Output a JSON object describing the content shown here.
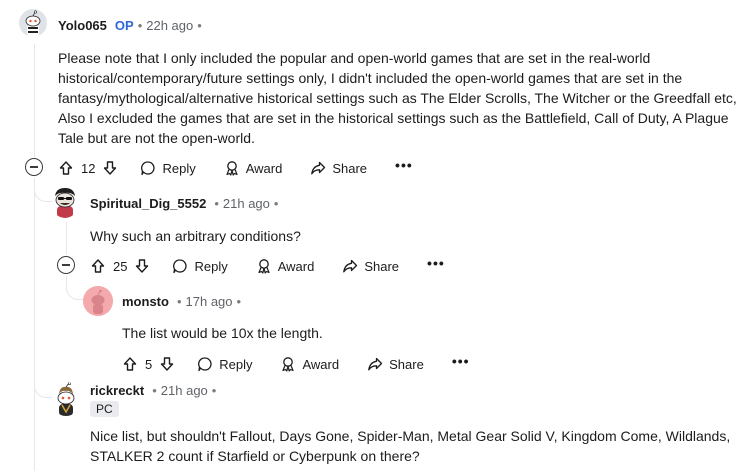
{
  "comments": [
    {
      "username": "Yolo065",
      "op_badge": "OP",
      "time": "22h ago",
      "text_lines": [
        "Please note that I only included the popular and open-world games that are set in the real-world",
        "historical/contemporary/future settings only, I didn't included the open-world games that are set in the",
        "fantasy/mythological/alternative historical settings such as The Elder Scrolls, The Witcher or the Greedfall etc,",
        "Also I excluded the games that are set in the historical settings such as the Battlefield, Call of Duty, A Plague",
        "Tale but are not the open-world."
      ],
      "votes": "12",
      "reply_label": "Reply",
      "award_label": "Award",
      "share_label": "Share",
      "more_label": "•••"
    },
    {
      "username": "Spiritual_Dig_5552",
      "time": "21h ago",
      "text": "Why such an arbitrary conditions?",
      "votes": "25",
      "reply_label": "Reply",
      "award_label": "Award",
      "share_label": "Share",
      "more_label": "•••"
    },
    {
      "username": "monsto",
      "time": "17h ago",
      "text": "The list would be 10x the length.",
      "votes": "5",
      "reply_label": "Reply",
      "award_label": "Award",
      "share_label": "Share",
      "more_label": "•••"
    },
    {
      "username": "rickreckt",
      "time": "21h ago",
      "flair": "PC",
      "text_lines": [
        "Nice list, but shouldn't Fallout, Days Gone, Spider-Man, Metal Gear Solid V, Kingdom Come, Wildlands,",
        "STALKER 2 count if Starfield or Cyberpunk on there?"
      ]
    }
  ],
  "separator": "•",
  "icons": {
    "upvote": "arrow-up-icon",
    "downvote": "arrow-down-icon",
    "reply": "speech-bubble-icon",
    "award": "award-ribbon-icon",
    "share": "share-arrow-icon",
    "collapse": "minus-circle-icon"
  },
  "colors": {
    "op_badge": "#2f67d8",
    "thread_line": "#e5e7ea",
    "monsto_avatar": "#f4a9ad",
    "flair_bg": "#e9ebee"
  }
}
